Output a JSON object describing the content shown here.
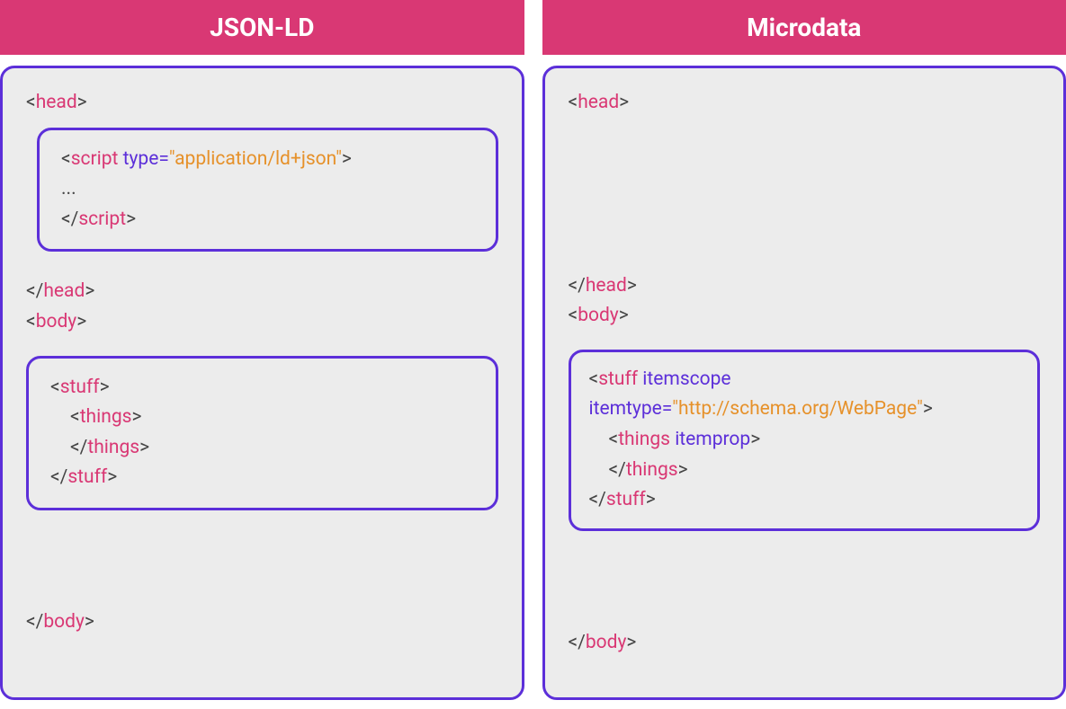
{
  "left": {
    "title": "JSON-LD",
    "head_open": {
      "b1": "<",
      "tag": "head",
      "b2": ">"
    },
    "head_close": {
      "b1": "</",
      "tag": "head",
      "b2": ">"
    },
    "body_open": {
      "b1": "<",
      "tag": "body",
      "b2": ">"
    },
    "body_close": {
      "b1": "</",
      "tag": "body",
      "b2": ">"
    },
    "script_open": {
      "b1": "<",
      "tag": "script",
      "sp": " ",
      "attr": "type=",
      "val": "\"application/ld+json\"",
      "b2": ">"
    },
    "script_close": {
      "b1": "</",
      "tag": "script",
      "b2": ">"
    },
    "ellipsis": "...",
    "stuff_open": {
      "b1": "<",
      "tag": "stuff",
      "b2": ">"
    },
    "stuff_close": {
      "b1": "</",
      "tag": "stuff",
      "b2": ">"
    },
    "things_open": {
      "b1": "<",
      "tag": "things",
      "b2": ">"
    },
    "things_close": {
      "b1": "</",
      "tag": "things",
      "b2": ">"
    }
  },
  "right": {
    "title": "Microdata",
    "head_open": {
      "b1": "<",
      "tag": "head",
      "b2": ">"
    },
    "head_close": {
      "b1": "</",
      "tag": "head",
      "b2": ">"
    },
    "body_open": {
      "b1": "<",
      "tag": "body",
      "b2": ">"
    },
    "body_close": {
      "b1": "</",
      "tag": "body",
      "b2": ">"
    },
    "stuff_open_l1": {
      "b1": "<",
      "tag": "stuff",
      "sp": " ",
      "attr": "itemscope"
    },
    "stuff_open_l2": {
      "attr": "itemtype=",
      "val": "\"http://schema.org/WebPage\"",
      "b2": ">"
    },
    "stuff_close": {
      "b1": "</",
      "tag": "stuff",
      "b2": ">"
    },
    "things_open": {
      "b1": "<",
      "tag": "things",
      "sp": " ",
      "attr": "itemprop",
      "b2": ">"
    },
    "things_close": {
      "b1": "</",
      "tag": "things",
      "b2": ">"
    }
  }
}
